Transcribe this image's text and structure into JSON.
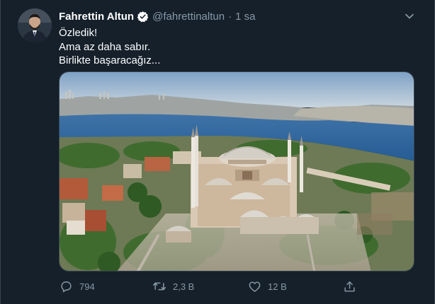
{
  "tweet": {
    "author_name": "Fahrettin Altun",
    "handle": "@fahrettinaltun",
    "separator": "·",
    "time": "1 sa",
    "text_lines": [
      "Özledik!",
      "Ama az daha sabır.",
      "Birlikte başaracağız..."
    ]
  },
  "actions": {
    "reply_count": "794",
    "retweet_count": "2,3 B",
    "like_count": "12 B"
  },
  "icons": {
    "verified": "verified-badge-icon",
    "caret": "chevron-down-icon",
    "reply": "reply-icon",
    "retweet": "retweet-icon",
    "like": "like-icon",
    "share": "share-icon"
  },
  "colors": {
    "background": "#15202b",
    "secondary_text": "#8899a6",
    "verified": "#ffffff",
    "border": "#38444d"
  }
}
